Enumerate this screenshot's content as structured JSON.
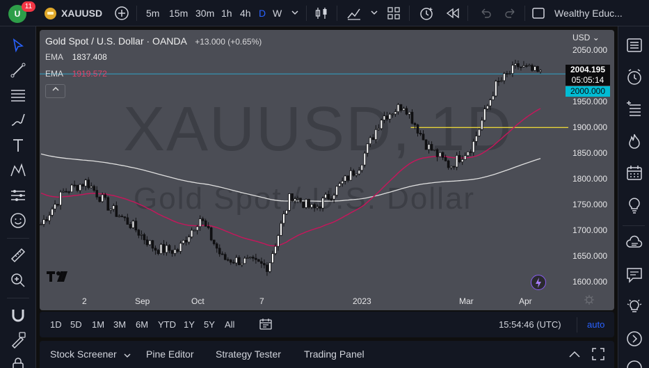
{
  "topbar": {
    "avatar_text": "U",
    "notifications": "11",
    "symbol": "XAUUSD",
    "intervals": [
      "5m",
      "15m",
      "30m",
      "1h",
      "4h",
      "D",
      "W"
    ],
    "active_interval": "D",
    "layout_name": "Wealthy Educ..."
  },
  "legend": {
    "title": "Gold Spot / U.S. Dollar · OANDA",
    "change": "+13.000 (+0.65%)",
    "ema1_label": "EMA",
    "ema1_value": "1837.408",
    "ema2_label": "EMA",
    "ema2_value": "1919.572"
  },
  "watermark": {
    "symbol": "XAUUSD, 1D",
    "name": "Gold Spot / U.S. Dollar"
  },
  "price_axis": {
    "currency": "USD",
    "labels": [
      "1600.000",
      "1650.000",
      "1700.000",
      "1750.000",
      "1800.000",
      "1850.000",
      "1900.000",
      "1950.000",
      "2050.000"
    ],
    "last_price": "2004.195",
    "countdown": "05:05:14",
    "alert_price": "2000.000"
  },
  "time_axis": {
    "labels": [
      "2",
      "Sep",
      "Oct",
      "7",
      "2023",
      "Mar",
      "Apr"
    ]
  },
  "range_bar": {
    "ranges": [
      "1D",
      "5D",
      "1M",
      "3M",
      "6M",
      "YTD",
      "1Y",
      "5Y",
      "All"
    ],
    "clock": "15:54:46 (UTC)",
    "auto_label": "auto"
  },
  "bottom_tabs": {
    "tabs": [
      "Stock Screener",
      "Pine Editor",
      "Strategy Tester",
      "Trading Panel"
    ]
  },
  "colors": {
    "ema_fast": "#c2185b",
    "ema_slow": "#e0e0e0",
    "horizontal_line": "#e6d23a",
    "last_price_line": "#2ea3c7",
    "alert_tag": "#00bcd4"
  },
  "chart_data": {
    "type": "candlestick",
    "instrument": "XAUUSD",
    "ylim": [
      1580,
      2060
    ],
    "x_labels": [
      "2",
      "Sep",
      "Oct",
      "7",
      "2023",
      "Mar",
      "Apr"
    ],
    "close_path": [
      {
        "x": "Jul 19",
        "close": 1712
      },
      {
        "x": "Aug 1",
        "close": 1775
      },
      {
        "x": "Aug 10",
        "close": 1795
      },
      {
        "x": "Aug 22",
        "close": 1745
      },
      {
        "x": "Sep 1",
        "close": 1710
      },
      {
        "x": "Sep 15",
        "close": 1665
      },
      {
        "x": "Sep 28",
        "close": 1660
      },
      {
        "x": "Oct 4",
        "close": 1725
      },
      {
        "x": "Oct 14",
        "close": 1645
      },
      {
        "x": "Oct 21",
        "close": 1640
      },
      {
        "x": "Nov 3",
        "close": 1630
      },
      {
        "x": "Nov 11",
        "close": 1770
      },
      {
        "x": "Nov 22",
        "close": 1740
      },
      {
        "x": "Dec 5",
        "close": 1780
      },
      {
        "x": "Dec 30",
        "close": 1825
      },
      {
        "x": "Jan 13",
        "close": 1920
      },
      {
        "x": "Feb 2",
        "close": 1945
      },
      {
        "x": "Feb 10",
        "close": 1865
      },
      {
        "x": "Feb 28",
        "close": 1825
      },
      {
        "x": "Mar 10",
        "close": 1865
      },
      {
        "x": "Mar 20",
        "close": 1980
      },
      {
        "x": "Apr 4",
        "close": 2020
      },
      {
        "x": "Apr 10",
        "close": 2004
      }
    ],
    "ema_fast": {
      "name": "EMA",
      "last": 1919.572
    },
    "ema_slow": {
      "name": "EMA",
      "last": 1837.408
    },
    "horizontal_level": 1900,
    "last_price": 2004.195,
    "alert_price": 2000
  }
}
